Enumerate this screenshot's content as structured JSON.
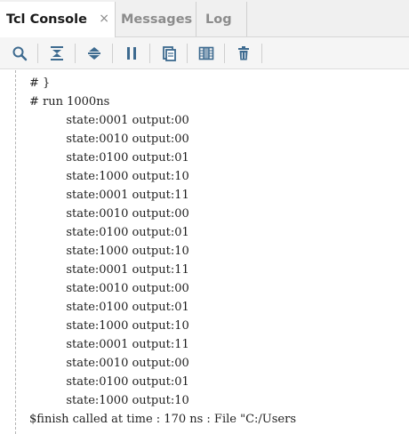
{
  "tabs": [
    {
      "label": "Tcl Console",
      "active": true,
      "close": "×"
    },
    {
      "label": "Messages",
      "active": false
    },
    {
      "label": "Log",
      "active": false
    }
  ],
  "toolbar": {
    "buttons": [
      {
        "name": "search-icon"
      },
      {
        "name": "collapse-all-icon"
      },
      {
        "name": "expand-all-icon"
      },
      {
        "name": "pause-icon"
      },
      {
        "name": "copy-icon"
      },
      {
        "name": "columns-icon"
      },
      {
        "name": "delete-icon"
      }
    ]
  },
  "console": {
    "lines": [
      "# }",
      "# run 1000ns",
      "          state:0001 output:00",
      "          state:0010 output:00",
      "          state:0100 output:01",
      "          state:1000 output:10",
      "          state:0001 output:11",
      "          state:0010 output:00",
      "          state:0100 output:01",
      "          state:1000 output:10",
      "          state:0001 output:11",
      "          state:0010 output:00",
      "          state:0100 output:01",
      "          state:1000 output:10",
      "          state:0001 output:11",
      "          state:0010 output:00",
      "          state:0100 output:01",
      "          state:1000 output:10",
      "$finish called at time : 170 ns : File \"C:/Users"
    ]
  },
  "colors": {
    "tab_active_text": "#1a1a1a",
    "tab_inactive_text": "#8c8c8c",
    "icon_blue": "#3d6a8f",
    "console_text": "#1f1f1f"
  }
}
